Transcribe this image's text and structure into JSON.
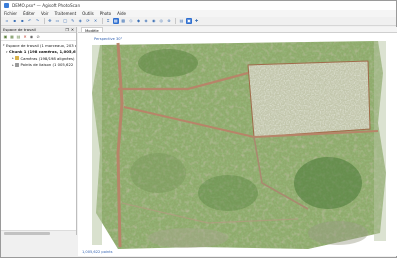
{
  "window": {
    "title": "DEMO.psx* — Agisoft PhotoScan"
  },
  "menu": {
    "items": [
      "Fichier",
      "Éditer",
      "Voir",
      "Traitement",
      "Outils",
      "Photo",
      "Aide"
    ]
  },
  "toolbar": {
    "buttons": [
      {
        "icon": "new-icon",
        "glyph": "▫"
      },
      {
        "icon": "open-icon",
        "glyph": "▪"
      },
      {
        "icon": "save-icon",
        "glyph": "▪"
      },
      {
        "icon": "undo-icon",
        "glyph": "↶"
      },
      {
        "icon": "redo-icon",
        "glyph": "↷"
      },
      {
        "icon": "navigation-icon",
        "glyph": "✥"
      },
      {
        "icon": "rect-select-icon",
        "glyph": "▭"
      },
      {
        "icon": "circle-select-icon",
        "glyph": "◯"
      },
      {
        "icon": "free-select-icon",
        "glyph": "✎"
      },
      {
        "icon": "resize-region-icon",
        "glyph": "◈"
      },
      {
        "icon": "rotate-region-icon",
        "glyph": "⟳"
      },
      {
        "icon": "delete-icon",
        "glyph": "✕"
      },
      {
        "icon": "crop-icon",
        "glyph": "⌗"
      },
      {
        "icon": "points-view-icon",
        "glyph": "▦",
        "active": true
      },
      {
        "icon": "dense-view-icon",
        "glyph": "▩"
      },
      {
        "icon": "mesh-view-icon",
        "glyph": "◇"
      },
      {
        "icon": "shaded-view-icon",
        "glyph": "◆"
      },
      {
        "icon": "textured-view-icon",
        "glyph": "◈"
      },
      {
        "icon": "tiled-view-icon",
        "glyph": "◉"
      },
      {
        "icon": "cameras-icon",
        "glyph": "◎"
      },
      {
        "icon": "reset-view-icon",
        "glyph": "⊕"
      },
      {
        "icon": "region-icon",
        "glyph": "▤"
      },
      {
        "icon": "ortho-icon",
        "glyph": "▣",
        "active": true
      },
      {
        "icon": "markers-icon",
        "glyph": "✚"
      }
    ]
  },
  "workspace": {
    "title": "Espace de travail",
    "tree": [
      {
        "label": "Espace de travail (1 morceaux, 203 cam",
        "level": 0,
        "color": "#6a8fc9"
      },
      {
        "label": "Chunk 1 (198 caméras, 1,005,622",
        "level": 1,
        "color": "#4b8b3b",
        "bold": true
      },
      {
        "label": "Caméras (198/198 alignées)",
        "level": 2,
        "color": "#d9b24a"
      },
      {
        "label": "Points de liaison (1 005,622",
        "level": 2,
        "color": "#9a9a9a"
      }
    ]
  },
  "viewer": {
    "tab": "Modèle",
    "projection_label": "Perspective 30°",
    "points_label": "1,005,622 points"
  },
  "colors": {
    "accent": "#2f6fd0",
    "label_blue": "#2e5fb0"
  }
}
